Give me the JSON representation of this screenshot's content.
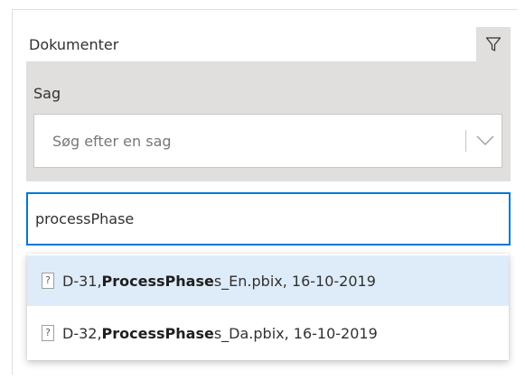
{
  "panel": {
    "title": "Dokumenter",
    "filter_icon": "filter-icon"
  },
  "sag": {
    "label": "Sag",
    "placeholder": "Søg efter en sag",
    "chevron_icon": "chevron-down-icon"
  },
  "search": {
    "value": "processPhase"
  },
  "results": [
    {
      "icon": "unknown-file-icon",
      "icon_glyph": "?",
      "prefix": "D-31, ",
      "match": "ProcessPhase",
      "suffix": "s_En.pbix, 16-10-2019",
      "highlighted": true
    },
    {
      "icon": "unknown-file-icon",
      "icon_glyph": "?",
      "prefix": "D-32, ",
      "match": "ProcessPhase",
      "suffix": "s_Da.pbix, 16-10-2019",
      "highlighted": false
    }
  ],
  "colors": {
    "accent": "#0078d4",
    "panel_gray": "#e1dfdd",
    "highlight": "#deecf9"
  }
}
